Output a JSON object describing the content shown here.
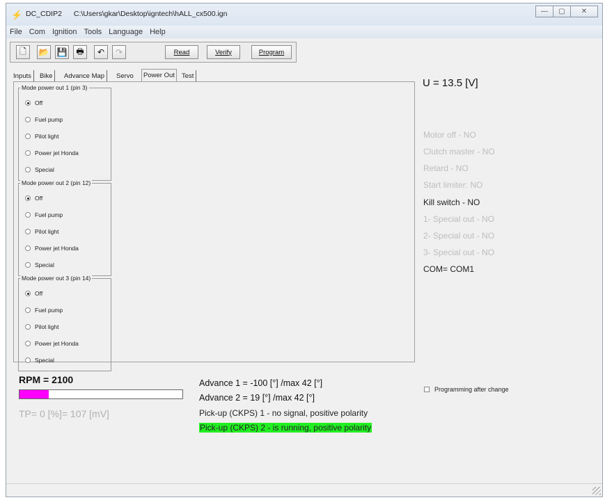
{
  "window": {
    "app_name": "DC_CDIP2",
    "file_path": "C:\\Users\\gkar\\Desktop\\igntech\\hALL_cx500.ign",
    "minimize": "—",
    "maximize": "▢",
    "close": "✕"
  },
  "menu": [
    "File",
    "Com",
    "Ignition",
    "Tools",
    "Language",
    "Help"
  ],
  "toolbar": {
    "read": "Read",
    "verify": "Verify",
    "program": "Program"
  },
  "tabs": [
    "Inputs",
    "Bike",
    "Advance Map",
    "Servo",
    "Power Out",
    "Test"
  ],
  "active_tab": "Power Out",
  "groups": [
    {
      "title": "Mode power out 1 (pin 3)",
      "options": [
        "Off",
        "Fuel pump",
        "Pilot light",
        "Power jet Honda",
        "Special"
      ],
      "selected": "Off"
    },
    {
      "title": "Mode power out 2 (pin 12)",
      "options": [
        "Off",
        "Fuel pump",
        "Pilot light",
        "Power jet Honda",
        "Special"
      ],
      "selected": "Off"
    },
    {
      "title": "Mode power out 3 (pin 14)",
      "options": [
        "Off",
        "Fuel pump",
        "Pilot light",
        "Power jet Honda",
        "Special"
      ],
      "selected": "Off"
    }
  ],
  "voltage": "U = 13.5 [V]",
  "status": [
    {
      "text": "Motor off - NO",
      "active": false
    },
    {
      "text": "Clutch master - NO",
      "active": false
    },
    {
      "text": "Retard - NO",
      "active": false
    },
    {
      "text": "Start limiter: NO",
      "active": false
    },
    {
      "text": "Kill switch - NO",
      "active": true
    },
    {
      "text": "1- Special out - NO",
      "active": false
    },
    {
      "text": "2- Special out - NO",
      "active": false
    },
    {
      "text": "3- Special out - NO",
      "active": false
    },
    {
      "text": "COM= COM1",
      "active": true
    }
  ],
  "rpm": "RPM = 2100",
  "rpm_bar_fraction": 0.18,
  "tp": "TP= 0 [%]= 107 [mV]",
  "advance1": "Advance 1 = -100 [°] /max 42 [°]",
  "advance2": "Advance 2 = 19 [°] /max 42 [°]",
  "pickup1": "Pick-up (CKPS) 1 - no signal, positive polarity",
  "pickup2": "Pick-up (CKPS) 2 - is running, positive polarity",
  "programming_after_change": "Programming after change",
  "colors": {
    "rpm_bar": "#ff00ff",
    "pickup_running": "#22ee22",
    "inactive_status": "#bdbdbd"
  }
}
